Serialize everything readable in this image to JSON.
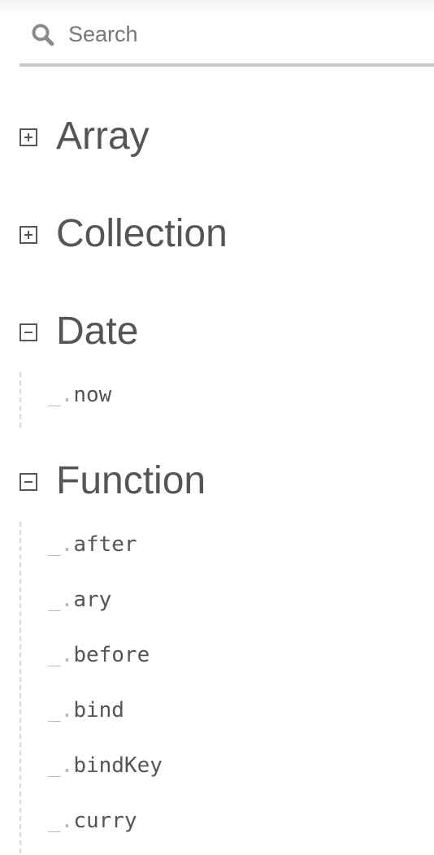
{
  "search": {
    "placeholder": "Search",
    "value": ""
  },
  "prefix": "_.",
  "categories": [
    {
      "name": "Array",
      "expanded": false,
      "methods": []
    },
    {
      "name": "Collection",
      "expanded": false,
      "methods": []
    },
    {
      "name": "Date",
      "expanded": true,
      "methods": [
        "now"
      ]
    },
    {
      "name": "Function",
      "expanded": true,
      "methods": [
        "after",
        "ary",
        "before",
        "bind",
        "bindKey",
        "curry"
      ]
    }
  ],
  "colors": {
    "text": "#555555",
    "prefix": "#b6b6b6",
    "search_underline": "#c8c8c8",
    "icon": "#8a8a8a"
  },
  "icons": {
    "search": "search-icon",
    "collapsed": "plus-square-icon",
    "expanded": "minus-square-icon"
  }
}
